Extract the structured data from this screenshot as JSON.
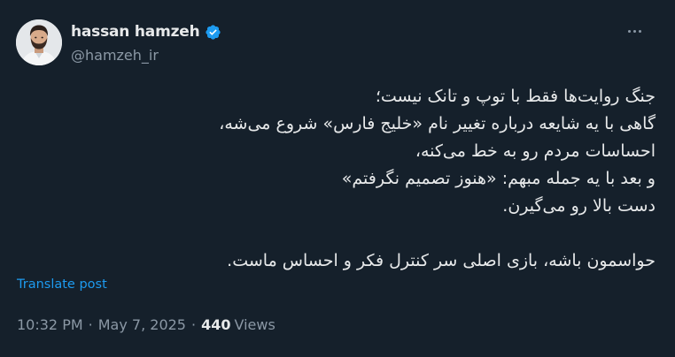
{
  "author": {
    "display_name": "hassan hamzeh",
    "handle": "@hamzeh_ir",
    "verified": true
  },
  "tweet": {
    "lines": [
      "جنگ روایت‌ها فقط با توپ و تانک نیست؛",
      "گاهی با یه شایعه درباره تغییر نام «خلیج فارس» شروع می‌شه،",
      "احساسات مردم رو به خط می‌کنه،",
      "و بعد با یه جمله مبهم: «هنوز تصمیم نگرفتم»",
      "دست بالا رو می‌گیرن.",
      "حواسمون باشه، بازی اصلی سر کنترل فکر و احساس  ماست."
    ]
  },
  "translate_label": "Translate post",
  "meta": {
    "time": "10:32 PM",
    "separator": "·",
    "date": "May 7, 2025",
    "views_count": "440",
    "views_label": "Views"
  },
  "colors": {
    "background": "#15202b",
    "text": "#e7e9ea",
    "secondary": "#8b98a5",
    "accent": "#1d9bf0"
  },
  "icons": {
    "verified": "verified-badge-icon",
    "more": "more-options-icon"
  }
}
